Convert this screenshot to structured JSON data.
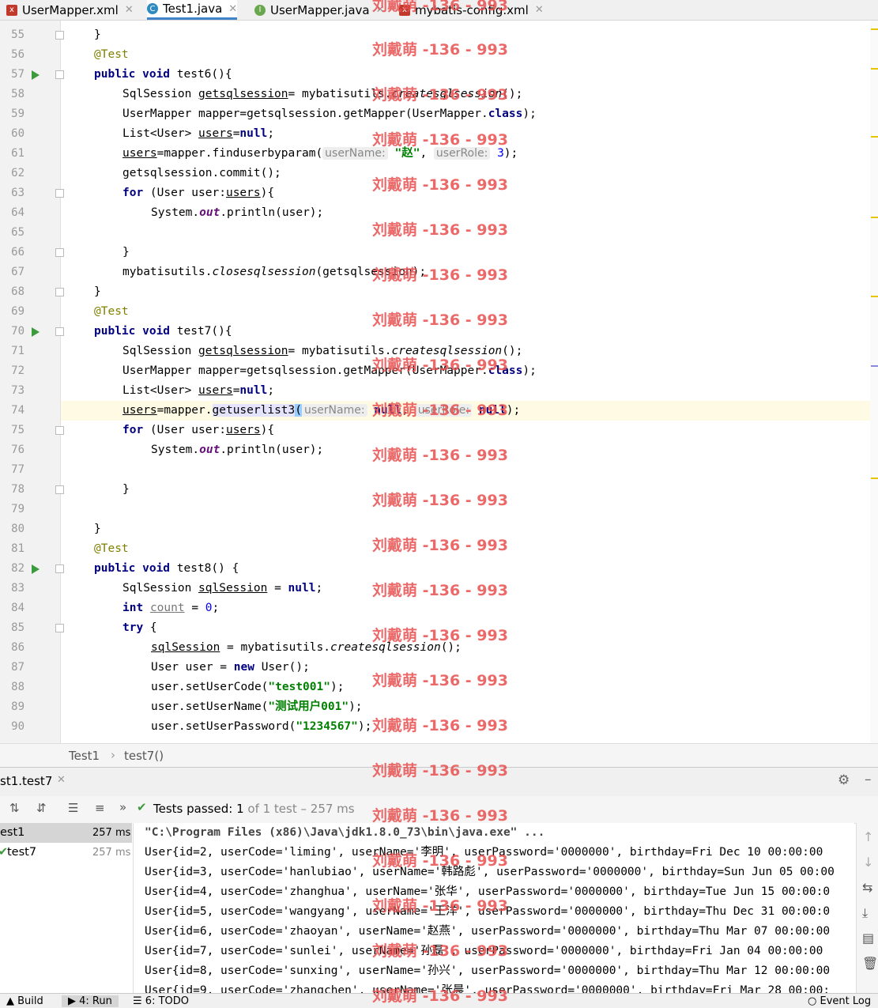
{
  "tabs": [
    {
      "label": "UserMapper.xml",
      "icon": "xml-file-icon",
      "color": "#c0392b"
    },
    {
      "label": "Test1.java",
      "icon": "class-icon",
      "color": "#2e8bc0"
    },
    {
      "label": "UserMapper.java",
      "icon": "interface-icon",
      "color": "#6aa84f"
    },
    {
      "label": "mybatis-config.xml",
      "icon": "xml-file-icon",
      "color": "#c0392b"
    }
  ],
  "watermark": "刘戴萌 -136 - 993",
  "code": {
    "line_numbers": [
      "55",
      "56",
      "57",
      "58",
      "59",
      "60",
      "61",
      "62",
      "63",
      "64",
      "65",
      "66",
      "67",
      "68",
      "69",
      "70",
      "71",
      "72",
      "73",
      "74",
      "75",
      "76",
      "77",
      "78",
      "79",
      "80",
      "81",
      "82",
      "83",
      "84",
      "85",
      "86",
      "87",
      "88",
      "89",
      "90"
    ],
    "t55": "}",
    "t56": "@Test",
    "t57_kw": "public void",
    "t57_rest": " test6(){",
    "t58_a": "SqlSession ",
    "t58_b": "getsqlsession",
    "t58_c": "= mybatisutils.",
    "t58_d": "createsqlsession",
    "t58_e": "();",
    "t59_a": "UserMapper mapper=getsqlsession.getMapper(UserMapper.",
    "t59_kw": "class",
    "t59_b": ");",
    "t60_a": "List<User> ",
    "t60_b": "users",
    "t60_c": "=",
    "t60_kw": "null",
    "t60_d": ";",
    "t61_a": "users",
    "t61_b": "=mapper.finduserbyparam(",
    "t61_h1": "userName:",
    "t61_s": "\"赵\"",
    "t61_c": ", ",
    "t61_h2": "userRole:",
    "t61_n": "3",
    "t61_d": ");",
    "t62": "getsqlsession.commit();",
    "t63_kw": "for",
    "t63_a": " (User user:",
    "t63_b": "users",
    "t63_c": "){",
    "t64_a": "System.",
    "t64_f": "out",
    "t64_b": ".println(user);",
    "t66": "}",
    "t67_a": "mybatisutils.",
    "t67_b": "closesqlsession",
    "t67_c": "(getsqlsession);",
    "t68": "}",
    "t69": "@Test",
    "t70_kw": "public void",
    "t70_rest": " test7(){",
    "t74_a": "users",
    "t74_b": "=mapper.",
    "t74_c": "getuserlist3",
    "t74_d": "(",
    "t74_h1": "userName:",
    "t74_kw1": "null",
    "t74_e": ", ",
    "t74_h2": "userRole:",
    "t74_kw2": "null",
    "t74_f": ");",
    "t78": "}",
    "t80": "}",
    "t81": "@Test",
    "t82_kw": "public void",
    "t82_rest": " test8() {",
    "t83_a": "SqlSession ",
    "t83_b": "sqlSession",
    "t83_c": " = ",
    "t83_kw": "null",
    "t83_d": ";",
    "t84_kw": "int",
    "t84_a": " ",
    "t84_b": "count",
    "t84_c": " = ",
    "t84_n": "0",
    "t84_d": ";",
    "t85_kw": "try",
    "t85_a": " {",
    "t86_a": "sqlSession",
    "t86_b": " = mybatisutils.",
    "t86_c": "createsqlsession",
    "t86_d": "();",
    "t87_a": "User user = ",
    "t87_kw": "new",
    "t87_b": " User();",
    "t88_a": "user.setUserCode(",
    "t88_s": "\"test001\"",
    "t88_b": ");",
    "t89_a": "user.setUserName(",
    "t89_s": "\"测试用户001\"",
    "t89_b": ");",
    "t90_a": "user.setUserPassword(",
    "t90_s": "\"1234567\"",
    "t90_b": ");"
  },
  "breadcrumb": {
    "class": "Test1",
    "method": "test7()"
  },
  "run_panel": {
    "tab_label": "st1.test7",
    "status_prefix": "Tests passed:",
    "passed": "1",
    "status_suffix": "of 1 test – 257 ms",
    "tree": [
      {
        "label": "est1",
        "time": "257 ms"
      },
      {
        "label": "test7",
        "time": "257 ms"
      }
    ]
  },
  "console_lines": [
    "\"C:\\Program Files (x86)\\Java\\jdk1.8.0_73\\bin\\java.exe\" ...",
    "User{id=2, userCode='liming', userName='李明', userPassword='0000000', birthday=Fri Dec 10 00:00:00",
    "User{id=3, userCode='hanlubiao', userName='韩路彪', userPassword='0000000', birthday=Sun Jun 05 00:00",
    "User{id=4, userCode='zhanghua', userName='张华', userPassword='0000000', birthday=Tue Jun 15 00:00:0",
    "User{id=5, userCode='wangyang', userName='王洋', userPassword='0000000', birthday=Thu Dec 31 00:00:0",
    "User{id=6, userCode='zhaoyan', userName='赵燕', userPassword='0000000', birthday=Thu Mar 07 00:00:00",
    "User{id=7, userCode='sunlei', userName='孙磊', userPassword='0000000', birthday=Fri Jan 04 00:00:00",
    "User{id=8, userCode='sunxing', userName='孙兴', userPassword='0000000', birthday=Thu Mar 12 00:00:00",
    "User{id=9, userCode='zhangchen', userName='张晨', userPassword='0000000', birthday=Fri Mar 28 00:00:"
  ],
  "bottom_tabs": [
    "Build",
    "4: Run",
    "6: TODO",
    "Event Log"
  ],
  "colors": {
    "keyword": "#000080",
    "string": "#008000",
    "annotation": "#808000",
    "accent": "#4083c9"
  }
}
